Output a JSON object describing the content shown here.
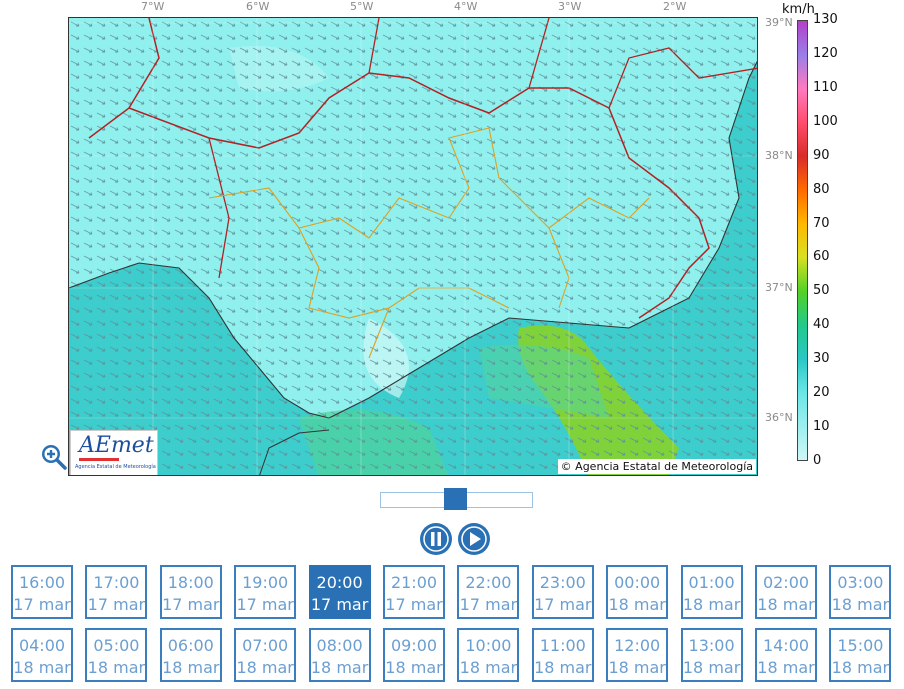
{
  "map": {
    "longitude_labels": [
      "7°W",
      "6°W",
      "5°W",
      "4°W",
      "3°W",
      "2°W"
    ],
    "latitude_labels": [
      "39°N",
      "38°N",
      "37°N",
      "36°N"
    ],
    "logo_text": "AEmet",
    "logo_subtitle": "Agencia Estatal de Meteorología",
    "copyright": "© Agencia Estatal de Meteorología"
  },
  "legend": {
    "unit": "km/h",
    "ticks": [
      "130",
      "120",
      "110",
      "100",
      "90",
      "80",
      "70",
      "60",
      "50",
      "40",
      "30",
      "20",
      "10",
      "0"
    ]
  },
  "player": {
    "pause_icon": "pause-icon",
    "play_icon": "play-icon",
    "zoom_icon": "zoom-in-icon",
    "slider_position": 0.5
  },
  "times": [
    {
      "time": "16:00",
      "date": "17 mar"
    },
    {
      "time": "17:00",
      "date": "17 mar"
    },
    {
      "time": "18:00",
      "date": "17 mar"
    },
    {
      "time": "19:00",
      "date": "17 mar"
    },
    {
      "time": "20:00",
      "date": "17 mar"
    },
    {
      "time": "21:00",
      "date": "17 mar"
    },
    {
      "time": "22:00",
      "date": "17 mar"
    },
    {
      "time": "23:00",
      "date": "17 mar"
    },
    {
      "time": "00:00",
      "date": "18 mar"
    },
    {
      "time": "01:00",
      "date": "18 mar"
    },
    {
      "time": "02:00",
      "date": "18 mar"
    },
    {
      "time": "03:00",
      "date": "18 mar"
    },
    {
      "time": "04:00",
      "date": "18 mar"
    },
    {
      "time": "05:00",
      "date": "18 mar"
    },
    {
      "time": "06:00",
      "date": "18 mar"
    },
    {
      "time": "07:00",
      "date": "18 mar"
    },
    {
      "time": "08:00",
      "date": "18 mar"
    },
    {
      "time": "09:00",
      "date": "18 mar"
    },
    {
      "time": "10:00",
      "date": "18 mar"
    },
    {
      "time": "11:00",
      "date": "18 mar"
    },
    {
      "time": "12:00",
      "date": "18 mar"
    },
    {
      "time": "13:00",
      "date": "18 mar"
    },
    {
      "time": "14:00",
      "date": "18 mar"
    },
    {
      "time": "15:00",
      "date": "18 mar"
    }
  ],
  "selected_time_index": 4,
  "colors": {
    "accent": "#2a70b4",
    "button_text": "#6b9fd1",
    "sea": "#35c9c9",
    "land": "#8ff0ee",
    "green_zone": "#7fd23a"
  }
}
